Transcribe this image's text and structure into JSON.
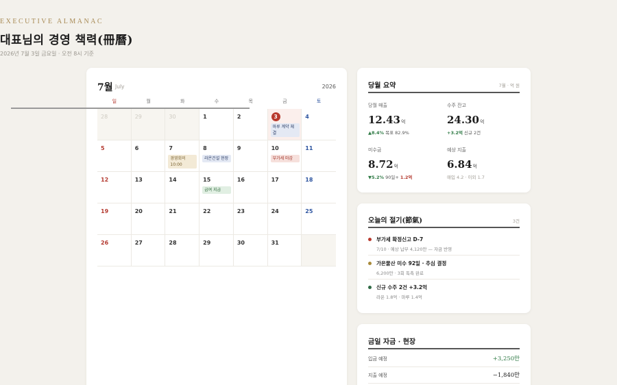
{
  "header": {
    "eyebrow": "EXECUTIVE ALMANAC",
    "title": "대표님의 경영 책력(冊曆)",
    "subtitle": "2026년 7월 3일 금요일 · 오전 8시 기준"
  },
  "calendar": {
    "month": "7월",
    "month_en": "July",
    "year": "2026",
    "weekdays": [
      "일",
      "월",
      "화",
      "수",
      "목",
      "금",
      "토"
    ],
    "weeks": [
      [
        {
          "day": "28",
          "muted": true
        },
        {
          "day": "29",
          "muted": true
        },
        {
          "day": "30",
          "muted": true
        },
        {
          "day": "1"
        },
        {
          "day": "2"
        },
        {
          "day": "3",
          "today": true,
          "event": {
            "label": "마루 계약 체결",
            "color": "blue"
          }
        },
        {
          "day": "4"
        }
      ],
      [
        {
          "day": "5"
        },
        {
          "day": "6"
        },
        {
          "day": "7",
          "event": {
            "label": "경영회의 10:00",
            "color": "gold"
          }
        },
        {
          "day": "8",
          "event": {
            "label": "라온건설 현장",
            "color": "blue"
          }
        },
        {
          "day": "9"
        },
        {
          "day": "10",
          "event": {
            "label": "부가세 마감",
            "color": "red"
          }
        },
        {
          "day": "11"
        }
      ],
      [
        {
          "day": "12"
        },
        {
          "day": "13"
        },
        {
          "day": "14"
        },
        {
          "day": "15",
          "event": {
            "label": "급여 지급",
            "color": "green"
          }
        },
        {
          "day": "16"
        },
        {
          "day": "17"
        },
        {
          "day": "18"
        }
      ],
      [
        {
          "day": "19"
        },
        {
          "day": "20"
        },
        {
          "day": "21"
        },
        {
          "day": "22"
        },
        {
          "day": "23"
        },
        {
          "day": "24"
        },
        {
          "day": "25"
        }
      ],
      [
        {
          "day": "26"
        },
        {
          "day": "27"
        },
        {
          "day": "28"
        },
        {
          "day": "29"
        },
        {
          "day": "30"
        },
        {
          "day": "31"
        },
        {
          "day": "",
          "muted": true
        }
      ]
    ]
  },
  "summary": {
    "title": "당월 요약",
    "meta": "7월 · 억 원",
    "kpis": [
      {
        "label": "당월 매출",
        "value": "12.43",
        "unit": "억",
        "delta_main": "▲8.4%",
        "delta_rest": " 목표 82.9%",
        "tone": "up"
      },
      {
        "label": "수주 잔고",
        "value": "24.30",
        "unit": "억",
        "delta_main": "+3.2억",
        "delta_rest": " 신규 2건",
        "tone": "up"
      },
      {
        "label": "미수금",
        "value": "8.72",
        "unit": "억",
        "delta_main": "▼5.2%",
        "delta_rest": " 90일+ ",
        "delta_extra": "1.2억",
        "tone": "down"
      },
      {
        "label": "예상 지출",
        "value": "6.84",
        "unit": "억",
        "delta_main": "",
        "delta_rest": "매입 4.2 · 이외 1.7",
        "tone": "muted"
      }
    ]
  },
  "alerts": {
    "title": "오늘의 절기(節氣)",
    "count": "3건",
    "items": [
      {
        "title": "부가세 확정신고 D-7",
        "sub": "7/10 · 예상 납부 4,120만 — 자금 반영",
        "color": "#b83a2e"
      },
      {
        "title": "가온물산 미수 92일 · 추심 결정",
        "sub": "6,200만 · 3회 독촉 완료",
        "color": "#a88a3a"
      },
      {
        "title": "신규 수주 2건 +3.2억",
        "sub": "라온 1.8억 · 마루 1.4억",
        "color": "#2f6a45"
      }
    ]
  },
  "cash": {
    "title": "금일 자금 · 현장",
    "rows": [
      {
        "label": "입금 예정",
        "amount": "+3,250만",
        "tone": "pos"
      },
      {
        "label": "지출 예정",
        "amount": "−1,840만",
        "tone": "negv"
      }
    ]
  }
}
